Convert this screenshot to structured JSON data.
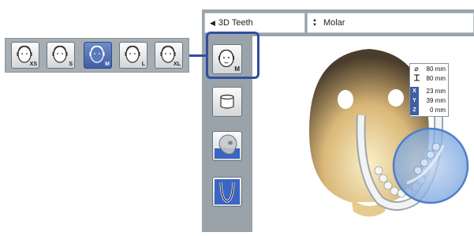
{
  "toolbar": {
    "view_select": {
      "value": "3D Teeth",
      "icon": "triangle-left-icon"
    },
    "tooth_select": {
      "value": "Molar",
      "icon": "up-down-arrows-icon"
    }
  },
  "size_palette": {
    "options": [
      {
        "label": "XS",
        "selected": false
      },
      {
        "label": "S",
        "selected": false
      },
      {
        "label": "M",
        "selected": true
      },
      {
        "label": "L",
        "selected": false
      },
      {
        "label": "XL",
        "selected": false
      }
    ]
  },
  "side_tools": [
    {
      "name": "head-size-m-button",
      "label": "M",
      "icon": "head-icon"
    },
    {
      "name": "cylinder-button",
      "icon": "cylinder-icon"
    },
    {
      "name": "skull-view-button",
      "icon": "skull-icon"
    },
    {
      "name": "jaw-arch-button",
      "icon": "jaw-arch-icon"
    }
  ],
  "measurements": {
    "diameter": "80 mm",
    "height": "80 mm",
    "x": "23 mm",
    "y": "39 mm",
    "z": "0 mm",
    "axis_x": "X",
    "axis_y": "Y",
    "axis_z": "Z"
  },
  "colors": {
    "accent": "#2f4fa1",
    "panel": "#9aa3aa",
    "selected": "#3f5fa3"
  }
}
